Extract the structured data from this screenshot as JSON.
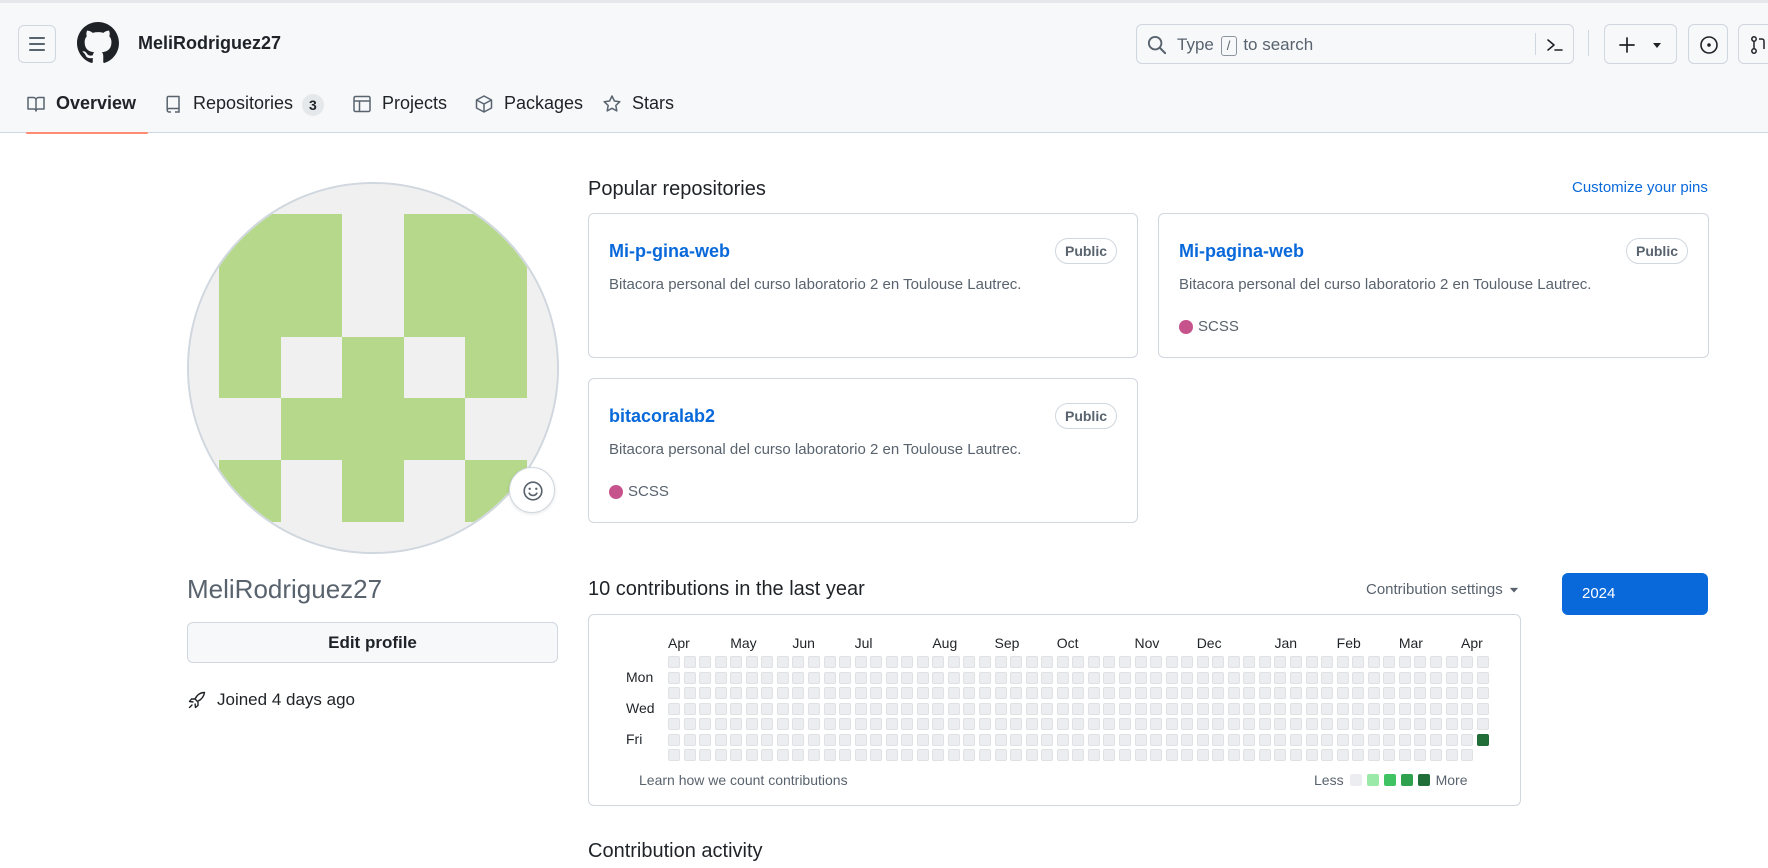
{
  "header": {
    "username": "MeliRodriguez27",
    "search": {
      "prefix": "Type",
      "key": "/",
      "suffix": "to search"
    },
    "icons": [
      "hamburger-icon",
      "github-logo-icon",
      "search-icon",
      "command-palette-icon",
      "plus-icon",
      "triangle-down-icon",
      "issue-opened-icon",
      "git-pull-request-icon"
    ]
  },
  "tabs": [
    {
      "label": "Overview",
      "icon": "book-icon",
      "active": true
    },
    {
      "label": "Repositories",
      "icon": "repo-icon",
      "count": "3"
    },
    {
      "label": "Projects",
      "icon": "table-icon"
    },
    {
      "label": "Packages",
      "icon": "package-icon"
    },
    {
      "label": "Stars",
      "icon": "star-icon"
    }
  ],
  "profile": {
    "login": "MeliRodriguez27",
    "edit_label": "Edit profile",
    "joined": "Joined 4 days ago",
    "avatar_colors": {
      "fill": "#b5d88a",
      "background": "#f0f0f0"
    }
  },
  "popular": {
    "title": "Popular repositories",
    "customize": "Customize your pins",
    "repos": [
      {
        "name": "Mi-p-gina-web",
        "visibility": "Public",
        "description": "Bitacora personal del curso laboratorio 2 en Toulouse Lautrec.",
        "language": ""
      },
      {
        "name": "Mi-pagina-web",
        "visibility": "Public",
        "description": "Bitacora personal del curso laboratorio 2 en Toulouse Lautrec.",
        "language": "SCSS"
      },
      {
        "name": "bitacoralab2",
        "visibility": "Public",
        "description": "Bitacora personal del curso laboratorio 2 en Toulouse Lautrec.",
        "language": "SCSS"
      }
    ],
    "language_color": "#c6538c"
  },
  "contributions": {
    "title": "10 contributions in the last year",
    "settings_label": "Contribution settings",
    "year": "2024",
    "months": [
      "Apr",
      "May",
      "Jun",
      "Jul",
      "Aug",
      "Sep",
      "Oct",
      "Nov",
      "Dec",
      "Jan",
      "Feb",
      "Mar",
      "Apr"
    ],
    "days": [
      "Mon",
      "Wed",
      "Fri"
    ],
    "learn": "Learn how we count contributions",
    "legend_less": "Less",
    "legend_more": "More",
    "levels": [
      "#ebedf0",
      "#9be9a8",
      "#40c463",
      "#30a14e",
      "#216e39"
    ],
    "active_cell": {
      "week": 52,
      "day": 5,
      "level": 4
    }
  },
  "activity": {
    "title": "Contribution activity"
  }
}
